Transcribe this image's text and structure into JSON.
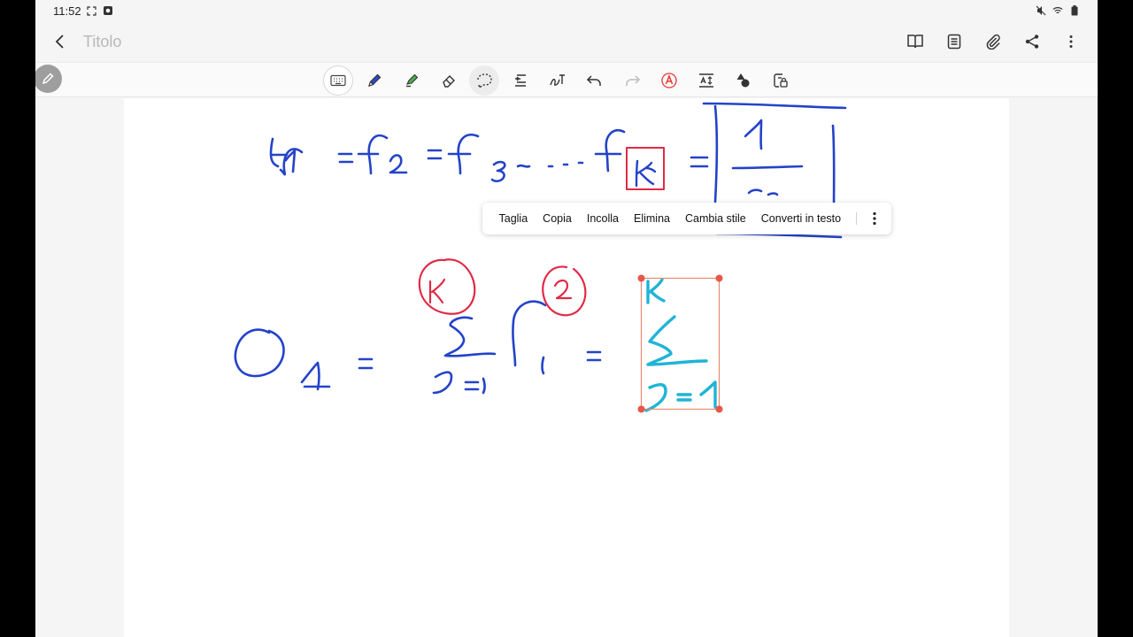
{
  "status": {
    "time": "11:52"
  },
  "header": {
    "title": "Titolo"
  },
  "toolbar": {
    "tools": [
      "keyboard-icon",
      "pen-icon",
      "highlighter-icon",
      "eraser-icon",
      "lasso-icon",
      "text-align-icon",
      "handwriting-to-text-icon",
      "undo-icon",
      "redo-icon",
      "text-recognition-icon",
      "text-size-icon",
      "shapes-icon",
      "read-only-lock-icon"
    ]
  },
  "context_menu": {
    "cut": "Taglia",
    "copy": "Copia",
    "paste": "Incolla",
    "delete": "Elimina",
    "change_style": "Cambia stile",
    "convert_to_text": "Converti in testo"
  },
  "colors": {
    "ink_blue": "#2443c9",
    "ink_red": "#e02a45",
    "ink_cyan": "#1fb4d6",
    "selection": "#e8896e",
    "handle": "#e5584a"
  }
}
